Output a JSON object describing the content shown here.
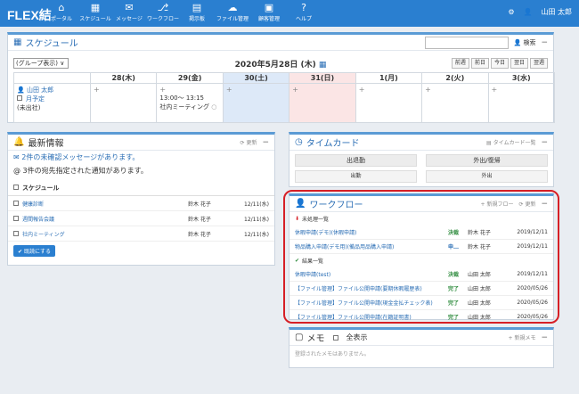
{
  "app": {
    "logo": "FLEX結"
  },
  "nav": [
    {
      "label": "ポータル",
      "icon": "home-icon",
      "glyph": "⌂"
    },
    {
      "label": "スケジュール",
      "icon": "calendar-icon",
      "glyph": "▦"
    },
    {
      "label": "メッセージ",
      "icon": "mail-icon",
      "glyph": "✉"
    },
    {
      "label": "ワークフロー",
      "icon": "workflow-icon",
      "glyph": "⎇"
    },
    {
      "label": "掲示板",
      "icon": "board-icon",
      "glyph": "▤"
    },
    {
      "label": "ファイル管理",
      "icon": "cloud-icon",
      "glyph": "☁"
    },
    {
      "label": "顧客管理",
      "icon": "customer-icon",
      "glyph": "▣"
    },
    {
      "label": "ヘルプ",
      "icon": "help-icon",
      "glyph": "?"
    }
  ],
  "user": {
    "name": "山田 太郎"
  },
  "schedule": {
    "title": "スケジュール",
    "search_label": "検索",
    "group_select": "(グループ表示)",
    "date": "2020年5月28日 (木)",
    "nav_buttons": [
      "前週",
      "前日",
      "今日",
      "翌日",
      "翌週"
    ],
    "days": [
      "28(木)",
      "29(金)",
      "30(土)",
      "31(日)",
      "1(月)",
      "2(火)",
      "3(水)"
    ],
    "user_name": "山田 太郎",
    "monthly_link": "月予定",
    "status": "(未出社)",
    "event_time": "13:00～ 13:15",
    "event_title": "社内ミーティング"
  },
  "info": {
    "title": "最新情報",
    "refresh": "更新",
    "unread_msg": "2件の未確認メッセージがあります。",
    "notice_msg": "3件の宛先指定された通知があります。",
    "section": "スケジュール",
    "items": [
      {
        "title": "健康診断",
        "name": "鈴木 花子",
        "date": "12/11(水)"
      },
      {
        "title": "週間報告会議",
        "name": "鈴木 花子",
        "date": "12/11(水)"
      },
      {
        "title": "社内ミーティング",
        "name": "鈴木 花子",
        "date": "12/11(水)"
      }
    ],
    "mark_read": "既読にする"
  },
  "timecard": {
    "title": "タイムカード",
    "list_label": "タイムカード一覧",
    "btn_in_out": "出退勤",
    "btn_out_return": "外出/復帰",
    "btn_in": "出勤",
    "btn_out": "外出"
  },
  "workflow": {
    "title": "ワークフロー",
    "new_flow": "新規フロー",
    "refresh": "更新",
    "pending_label": "未処理一覧",
    "done_label": "結果一覧",
    "pending": [
      {
        "title": "休暇申請(デモ)(休暇申請)",
        "status": "決裁",
        "user": "鈴木 花子",
        "date": "2019/12/11"
      },
      {
        "title": "物品購入申請(デモ用)(備品用品購入申請)",
        "status": "申…",
        "user": "鈴木 花子",
        "date": "2019/12/11"
      }
    ],
    "done": [
      {
        "title": "休暇申請(test)",
        "status": "決裁",
        "user": "山田 太郎",
        "date": "2019/12/11"
      },
      {
        "title": "【ファイル管理】ファイル公開申請(要期休暇履歴表)",
        "status": "完了",
        "user": "山田 太郎",
        "date": "2020/05/26"
      },
      {
        "title": "【ファイル管理】ファイル公開申請(現金金払チェック表)",
        "status": "完了",
        "user": "山田 太郎",
        "date": "2020/05/26"
      },
      {
        "title": "【ファイル管理】ファイル公開申請(在籍証明書)",
        "status": "完了",
        "user": "山田 太郎",
        "date": "2020/05/26"
      }
    ]
  },
  "memo": {
    "title": "メモ",
    "show_all": "全表示",
    "new_memo": "新規メモ",
    "empty": "登録されたメモはありません。"
  },
  "colors": {
    "header": "#2a7fd0",
    "accent": "#2a6eb5",
    "highlight": "#d61f26",
    "status_green": "#2e8b3d"
  }
}
